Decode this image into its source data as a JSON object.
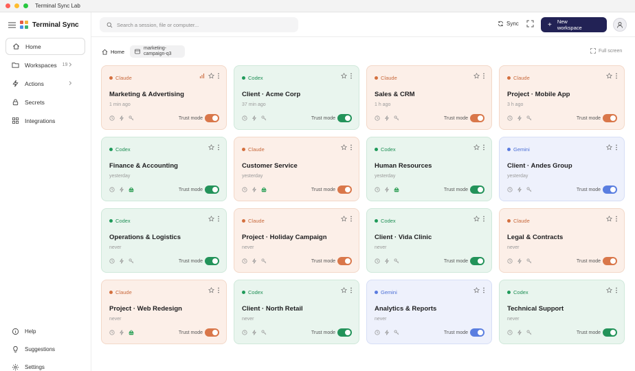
{
  "window": {
    "title": "Terminal Sync Lab",
    "traffic_colors": [
      "#ff5f57",
      "#febc2e",
      "#28c840"
    ]
  },
  "brand": {
    "name": "Terminal Sync",
    "logo_colors": [
      "#e45b47",
      "#f2b33d",
      "#4a8fe7",
      "#3bb273"
    ]
  },
  "sidebar": {
    "items": [
      {
        "label": "Home",
        "icon": "home-icon"
      },
      {
        "label": "Workspaces",
        "icon": "folder-icon",
        "count": "19"
      },
      {
        "label": "Actions",
        "icon": "bolt-icon"
      },
      {
        "label": "Secrets",
        "icon": "lock-icon"
      },
      {
        "label": "Integrations",
        "icon": "grid-icon"
      }
    ],
    "footer": [
      {
        "label": "Help",
        "icon": "info-icon"
      },
      {
        "label": "Suggestions",
        "icon": "lightbulb-icon"
      },
      {
        "label": "Settings",
        "icon": "gear-icon"
      }
    ]
  },
  "header": {
    "search_placeholder": "Search a session, file or computer...",
    "sync_label": "Sync",
    "new_workspace_line1": "New",
    "new_workspace_line2": "workspace",
    "new_workspace_plus": "+"
  },
  "breadcrumb": {
    "home": "Home",
    "workspace": "marketing-campaign-q3",
    "fullscreen": "Full screen"
  },
  "trust_label": "Trust mode",
  "colors": {
    "claude": "#d9774a",
    "codex": "#23935a",
    "gemini": "#5a7ee0",
    "primary": "#222255"
  },
  "cards": [
    {
      "agent": "Claude",
      "kind": "claude",
      "title": "Marketing & Advertising",
      "time": "1 min ago",
      "chart": true,
      "drive": false
    },
    {
      "agent": "Codex",
      "kind": "codex",
      "title": "Client · Acme Corp",
      "time": "37 min ago",
      "chart": false,
      "drive": false
    },
    {
      "agent": "Claude",
      "kind": "claude",
      "title": "Sales & CRM",
      "time": "1 h ago",
      "chart": false,
      "drive": false
    },
    {
      "agent": "Claude",
      "kind": "claude",
      "title": "Project · Mobile App",
      "time": "3 h ago",
      "chart": false,
      "drive": false
    },
    {
      "agent": "Codex",
      "kind": "codex",
      "title": "Finance & Accounting",
      "time": "yesterday",
      "chart": false,
      "drive": true
    },
    {
      "agent": "Claude",
      "kind": "claude",
      "title": "Customer Service",
      "time": "yesterday",
      "chart": false,
      "drive": true
    },
    {
      "agent": "Codex",
      "kind": "codex",
      "title": "Human Resources",
      "time": "yesterday",
      "chart": false,
      "drive": true
    },
    {
      "agent": "Gemini",
      "kind": "gemini",
      "title": "Client · Andes Group",
      "time": "yesterday",
      "chart": false,
      "drive": false
    },
    {
      "agent": "Codex",
      "kind": "codex",
      "title": "Operations & Logistics",
      "time": "never",
      "chart": false,
      "drive": false
    },
    {
      "agent": "Claude",
      "kind": "claude",
      "title": "Project · Holiday Campaign",
      "time": "never",
      "chart": false,
      "drive": false
    },
    {
      "agent": "Codex",
      "kind": "codex",
      "title": "Client · Vida Clinic",
      "time": "never",
      "chart": false,
      "drive": false
    },
    {
      "agent": "Claude",
      "kind": "claude",
      "title": "Legal & Contracts",
      "time": "never",
      "chart": false,
      "drive": false
    },
    {
      "agent": "Claude",
      "kind": "claude",
      "title": "Project · Web Redesign",
      "time": "never",
      "chart": false,
      "drive": true
    },
    {
      "agent": "Codex",
      "kind": "codex",
      "title": "Client · North Retail",
      "time": "never",
      "chart": false,
      "drive": false
    },
    {
      "agent": "Gemini",
      "kind": "gemini",
      "title": "Analytics & Reports",
      "time": "never",
      "chart": false,
      "drive": false
    },
    {
      "agent": "Codex",
      "kind": "codex",
      "title": "Technical Support",
      "time": "never",
      "chart": false,
      "drive": false
    }
  ]
}
